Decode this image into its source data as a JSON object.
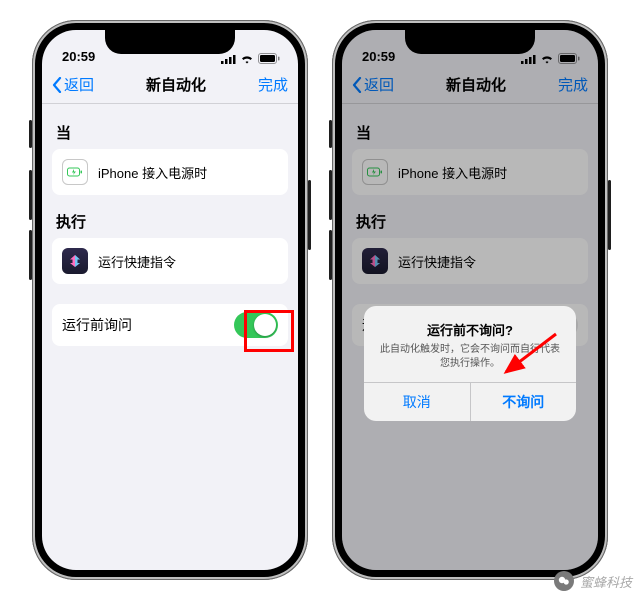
{
  "statusbar": {
    "time": "20:59"
  },
  "nav": {
    "back": "返回",
    "title": "新自动化",
    "done": "完成"
  },
  "sections": {
    "when": "当",
    "do": "执行"
  },
  "cells": {
    "trigger": "iPhone 接入电源时",
    "action": "运行快捷指令",
    "ask_before": "运行前询问"
  },
  "alert": {
    "title": "运行前不询问?",
    "message": "此自动化触发时，它会不询问而自行代表您执行操作。",
    "cancel": "取消",
    "confirm": "不询问"
  },
  "watermark": "蜜蜂科技"
}
